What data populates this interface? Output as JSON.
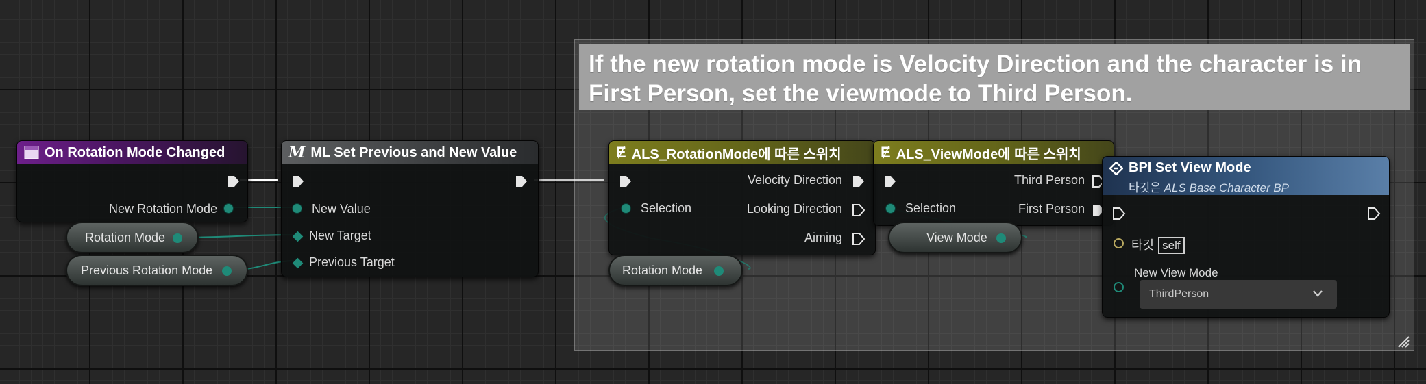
{
  "comment": {
    "text": "If the new rotation mode is Velocity Direction and the character is in First Person, set the viewmode to Third Person."
  },
  "nodes": {
    "event": {
      "title": "On Rotation Mode Changed",
      "output_label": "New Rotation Mode",
      "color": "#6d1f8a"
    },
    "ml_set": {
      "title": "ML Set Previous and New Value",
      "inputs": [
        "New Value",
        "New Target",
        "Previous Target"
      ]
    },
    "switch_rotation": {
      "title": "ALS_RotationMode에 따른 스위치",
      "input_label": "Selection",
      "outputs": [
        "Velocity Direction",
        "Looking Direction",
        "Aiming"
      ],
      "color": "#7d7d1e"
    },
    "switch_view": {
      "title": "ALS_ViewMode에 따른 스위치",
      "input_label": "Selection",
      "outputs": [
        "Third Person",
        "First Person"
      ],
      "color": "#7d7d1e"
    },
    "bpi": {
      "title": "BPI Set View Mode",
      "subtitle_prefix": "타깃은",
      "subtitle_target": "ALS Base Character BP",
      "target_label": "타깃",
      "target_value": "self",
      "param_label": "New View Mode",
      "param_value": "ThirdPerson",
      "color": "#35577e"
    }
  },
  "getters": {
    "rotation_mode_1": "Rotation Mode",
    "previous_rotation_mode": "Previous Rotation Mode",
    "rotation_mode_2": "Rotation Mode",
    "view_mode": "View Mode"
  },
  "colors": {
    "data_pin": "#1f8a78",
    "exec_wire": "#ffffff",
    "canvas": "#262626"
  }
}
